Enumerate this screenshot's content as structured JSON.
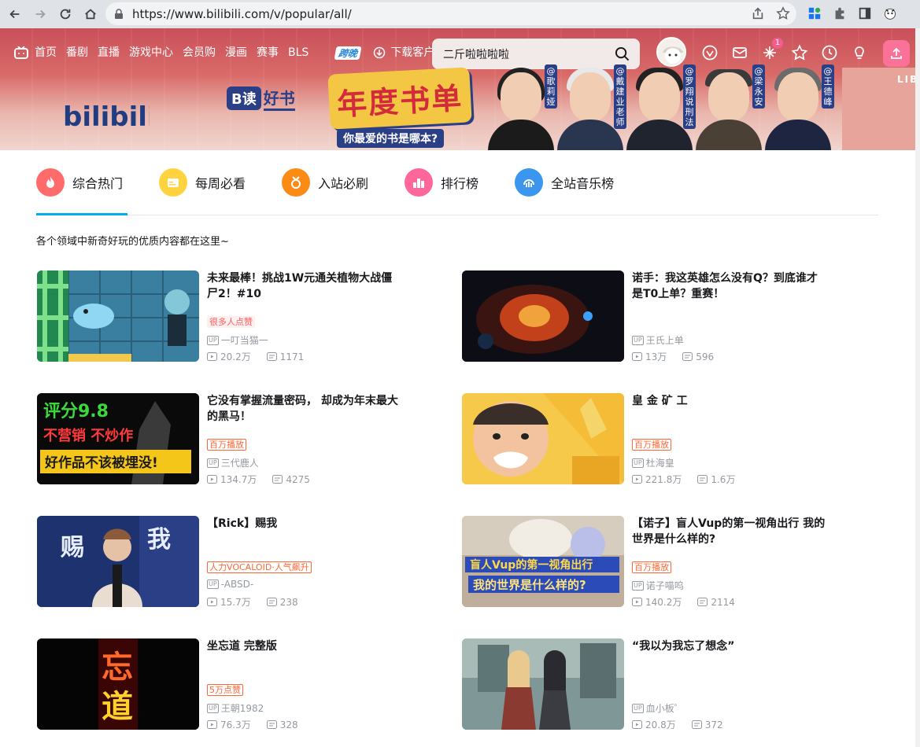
{
  "browser": {
    "url": "https://www.bilibili.com/v/popular/all/"
  },
  "header": {
    "nav": [
      "首页",
      "番剧",
      "直播",
      "游戏中心",
      "会员购",
      "漫画",
      "赛事",
      "BLS"
    ],
    "ku_label": "跨晚",
    "download_label": "下载客户端",
    "search_value": "二斤啦啦啦啦",
    "notification_count": "1"
  },
  "banner": {
    "logo_text": "bilibili",
    "bdu_b": "B读",
    "bdu_hs": "好书",
    "main_title": "年度书单",
    "sub_title": "你最爱的书是哪本?",
    "persons": [
      "@歌莉娅",
      "@戴建业老师",
      "@罗翔说刑法",
      "@梁永安",
      "@王德峰"
    ],
    "building_text": "LIB"
  },
  "tabs": [
    {
      "label": "综合热门",
      "color": "#ff6b6b"
    },
    {
      "label": "每周必看",
      "color": "#ffd33d"
    },
    {
      "label": "入站必刷",
      "color": "#fa8c16"
    },
    {
      "label": "排行榜",
      "color": "#ff6699"
    },
    {
      "label": "全站音乐榜",
      "color": "#3a96ee"
    }
  ],
  "subtitle": "各个领域中新奇好玩的优质内容都在这里~",
  "videos": [
    {
      "title": "未来最棒！挑战1W元通关植物大战僵尸2！#10",
      "tag": "很多人点赞",
      "up": "一叮当猫一",
      "views": "20.2万",
      "danmaku": "1171"
    },
    {
      "title": "诺手：我这英雄怎么没有Q？到底谁才是T0上单？重赛！",
      "tag": "",
      "up": "王氏上单",
      "views": "13万",
      "danmaku": "596"
    },
    {
      "title": "它没有掌握流量密码， 却成为年末最大的黑马！",
      "tag": "百万播放",
      "up": "三代鹿人",
      "views": "134.7万",
      "danmaku": "4275"
    },
    {
      "title": "皇 金 矿 工",
      "tag": "百万播放",
      "up": "杜海皇",
      "views": "221.8万",
      "danmaku": "1.6万"
    },
    {
      "title": "【Rick】赐我",
      "tag": "人力VOCALOID·人气飙升",
      "up": "-ABSD-",
      "views": "15.7万",
      "danmaku": "238"
    },
    {
      "title": "【诺子】盲人Vup的第一视角出行 我的世界是什么样的?",
      "tag": "百万播放",
      "up": "诺子喵呜",
      "views": "140.2万",
      "danmaku": "2114"
    },
    {
      "title": "坐忘道 完整版",
      "tag": "5万点赞",
      "up": "王朝1982",
      "views": "76.3万",
      "danmaku": "328"
    },
    {
      "title": "“我以为我忘了想念”",
      "tag": "",
      "up": "血小板゜",
      "views": "20.8万",
      "danmaku": "372"
    }
  ],
  "thumb_text": {
    "t3_line1": "评分9.8",
    "t3_line2": "不营销 不炒作",
    "t3_line3": "好作品不该被埋没!",
    "t5_a": "赐",
    "t5_b": "我",
    "t6_line1": "盲人Vup的第一视角出行",
    "t6_line2": "我的世界是什么样的?",
    "t7_a": "忘",
    "t7_b": "道"
  }
}
